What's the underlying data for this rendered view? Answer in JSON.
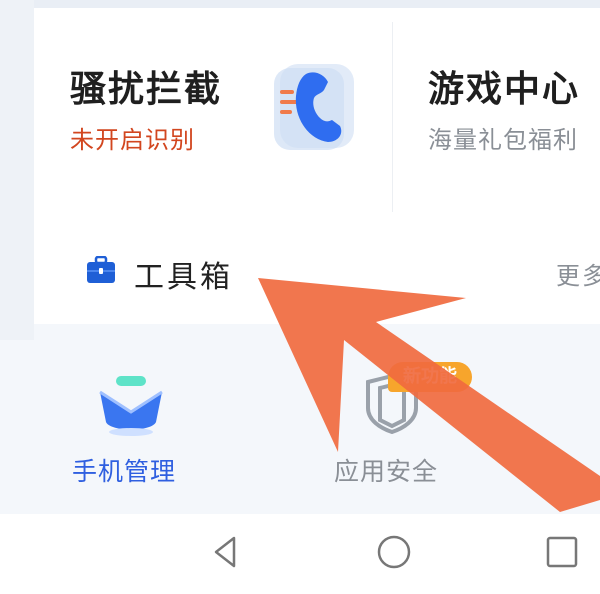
{
  "cards": [
    {
      "title": "骚扰拦截",
      "subtitle": "未开启识别",
      "icon": "phone-shield-icon"
    },
    {
      "title": "游戏中心",
      "subtitle": "海量礼包福利",
      "icon": "game-icon"
    }
  ],
  "toolbox": {
    "label": "工具箱",
    "more": "更多",
    "icon": "toolbox-icon"
  },
  "bottom_nav": [
    {
      "label": "手机管理",
      "icon": "phone-manage-icon",
      "active": true
    },
    {
      "label": "应用安全",
      "icon": "app-security-icon",
      "active": false,
      "badge": "新功能"
    }
  ],
  "system_nav": [
    "back-icon",
    "home-icon",
    "recents-icon"
  ],
  "colors": {
    "warning": "#d2461f",
    "active": "#2f5fe0",
    "inactive": "#8a8f96",
    "badge": "#f7a52c",
    "arrow": "#f06a3f"
  }
}
